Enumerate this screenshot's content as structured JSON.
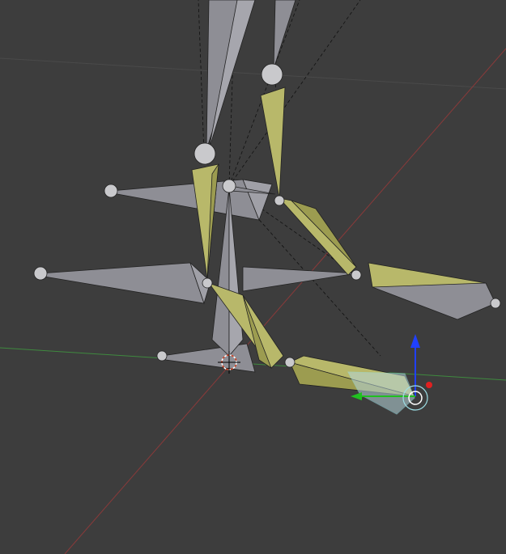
{
  "viewport": {
    "mode": "3d-viewport-pose",
    "background_color": "#3d3d3d",
    "grid_color": "#4a4a4a",
    "x_axis_color": "#8a3a3a",
    "y_axis_color": "#3f8a3f"
  },
  "bones": {
    "unselected_color": "#8e8e95",
    "selected_color": "#b8b86a",
    "active_color": "#b7d6dc",
    "joint_color": "#c9c9cc"
  },
  "gizmo": {
    "z_axis_color": "#2040ff",
    "y_axis_color": "#20c020",
    "x_axis_color": "#e02020",
    "center_color": "#ffffff",
    "ring_color": "#9edfe6"
  },
  "cursor_3d": {
    "outer_color": "#ffffff",
    "inner_color": "#d04020"
  }
}
